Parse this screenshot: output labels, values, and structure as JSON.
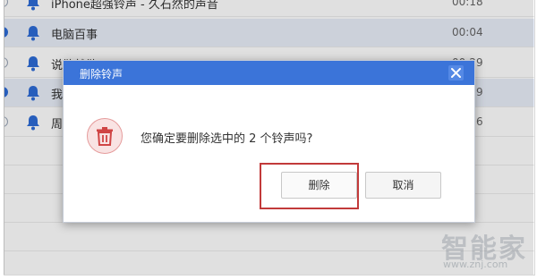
{
  "list": {
    "rows": [
      {
        "title": "iPhone超强铃声 - 久石然的声音",
        "duration": "00:18",
        "selected": false
      },
      {
        "title": "电脑百事",
        "duration": "00:04",
        "selected": true
      },
      {
        "title": "说散就散",
        "duration": "00:29",
        "selected": false
      },
      {
        "title": "我的天空",
        "duration": "00:29",
        "selected": true
      },
      {
        "title": "周杰伦",
        "duration": "00:16",
        "selected": false
      }
    ]
  },
  "dialog": {
    "title": "删除铃声",
    "message": "您确定要删除选中的 2 个铃声吗?",
    "delete_label": "删除",
    "cancel_label": "取消"
  },
  "watermark": {
    "brand": "智能家",
    "url": "www.znj.com"
  },
  "colors": {
    "accent": "#3b74d9",
    "danger": "#c23a3a",
    "bell": "#2d6bd6"
  }
}
